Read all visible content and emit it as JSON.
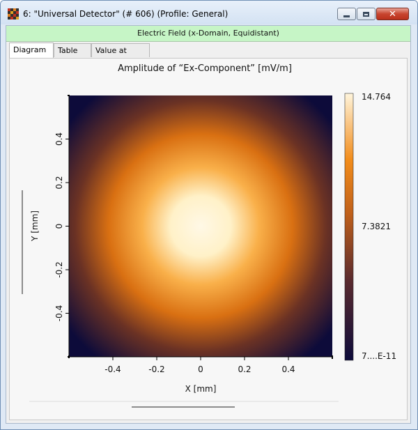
{
  "window": {
    "title": "6: \"Universal Detector\" (# 606) (Profile: General)",
    "minimize_icon": "minimize-icon",
    "maximize_icon": "maximize-icon",
    "close_icon": "close-icon"
  },
  "header": {
    "label": "Electric Field (x-Domain, Equidistant)"
  },
  "tabs": [
    {
      "label": "Diagram",
      "active": true
    },
    {
      "label": "Table",
      "active": false
    },
    {
      "label": "Value at (x,y)",
      "active": false
    }
  ],
  "chart_data": {
    "type": "heatmap",
    "title": "Amplitude of “Ex-Component”  [mV/m]",
    "xlabel": "X [mm]",
    "ylabel": "Y [mm]",
    "xlim": [
      -0.6,
      0.6
    ],
    "ylim": [
      -0.6,
      0.6
    ],
    "x_ticks": [
      "-0.4",
      "-0.2",
      "0",
      "0.2",
      "0.4"
    ],
    "y_ticks": [
      "0.4",
      "0.2",
      "0",
      "-0.2",
      "-0.4"
    ],
    "x_tick_values": [
      -0.4,
      -0.2,
      0,
      0.2,
      0.4
    ],
    "y_tick_values": [
      0.4,
      0.2,
      0,
      -0.2,
      -0.4
    ],
    "peak": {
      "x": 0,
      "y": 0,
      "value": 14.764
    },
    "colorbar": {
      "max_label": "14.764",
      "mid_label": "7.3821",
      "min_label": "7....E-11",
      "max": 14.764,
      "mid": 7.3821,
      "colors": [
        "#0d0b3a",
        "#5a2a2e",
        "#c0601a",
        "#f28c1a",
        "#fff5dc"
      ]
    }
  }
}
